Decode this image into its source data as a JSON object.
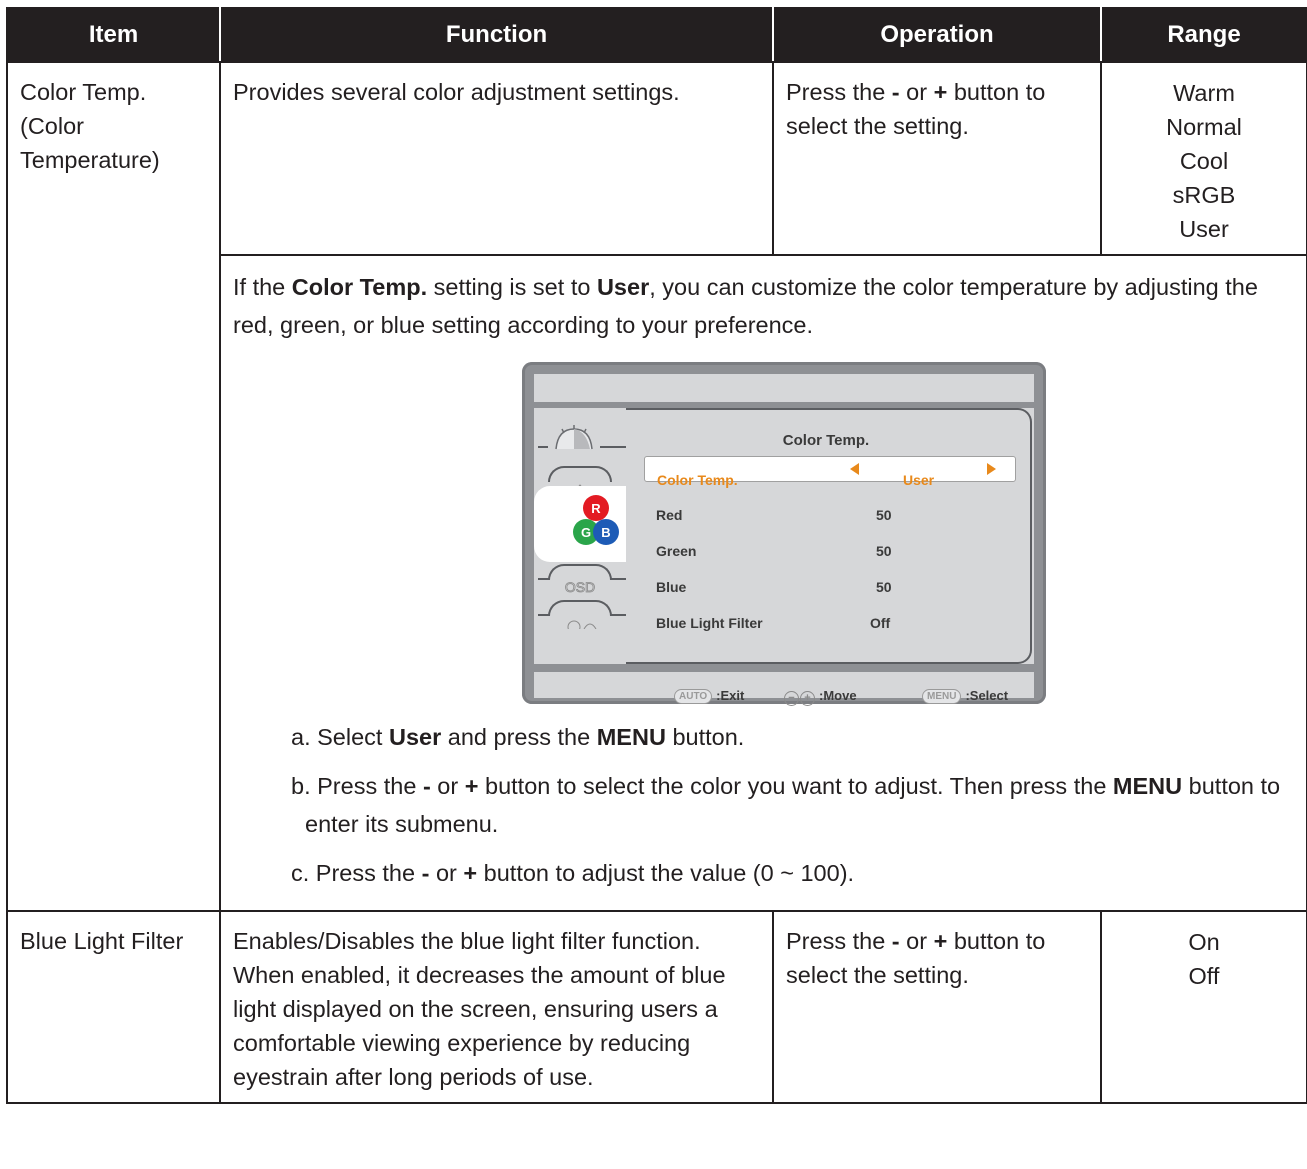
{
  "headers": {
    "item": "Item",
    "function": "Function",
    "operation": "Operation",
    "range": "Range"
  },
  "color_temp": {
    "item": "Color Temp. (Color Temperature)",
    "function": "Provides several color adjustment settings.",
    "operation_pre": "Press the ",
    "minus": "-",
    "or": " or ",
    "plus": "+",
    "operation_post": " button to select the setting.",
    "range": [
      "Warm",
      "Normal",
      "Cool",
      "sRGB",
      "User"
    ]
  },
  "user_note": {
    "t1": "If the ",
    "b1": "Color Temp.",
    "t2": " setting is set to ",
    "b2": "User",
    "t3": ", you can customize the color temperature by adjusting the red, green, or blue setting according to your preference."
  },
  "osd": {
    "title": "Color Temp.",
    "highlight_color": "#e8891b",
    "tab_icons": [
      "brightness-icon",
      "image-icon",
      "rgb-icon",
      "osd-icon",
      "settings-icon"
    ],
    "rows": [
      {
        "label": "Color Temp.",
        "value": "User"
      },
      {
        "label": "Red",
        "value": "50"
      },
      {
        "label": "Green",
        "value": "50"
      },
      {
        "label": "Blue",
        "value": "50"
      },
      {
        "label": "Blue Light Filter",
        "value": "Off"
      }
    ],
    "footer": {
      "auto_btn": "AUTO",
      "exit": ":Exit",
      "move": ":Move",
      "menu_btn": "MENU",
      "select": ":Select"
    }
  },
  "steps": [
    {
      "prefix": "a. Select ",
      "b1": "User",
      "mid": " and press the ",
      "b2": "MENU",
      "suffix": " button."
    },
    {
      "prefix": "b. Press the ",
      "minus": "-",
      "or": " or ",
      "plus": "+",
      "mid": " button to select the color you want to adjust. Then press the ",
      "b2": "MENU",
      "suffix": " button to enter its submenu."
    },
    {
      "prefix": "c. Press the ",
      "minus": "-",
      "or": " or ",
      "plus": "+",
      "suffix": " button to adjust the value (0 ~ 100)."
    }
  ],
  "blue_light": {
    "item": "Blue Light Filter",
    "function": "Enables/Disables the blue light filter function. When enabled, it decreases the amount of blue light displayed on the screen, ensuring users a comfortable viewing experience by reducing eyestrain after long periods of use.",
    "operation_pre": "Press the ",
    "minus": "-",
    "or": " or ",
    "plus": "+",
    "operation_post": " button to select the setting.",
    "range": [
      "On",
      "Off"
    ]
  }
}
